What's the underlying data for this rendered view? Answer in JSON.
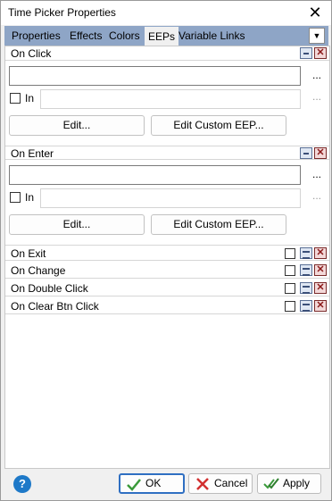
{
  "window": {
    "title": "Time Picker Properties"
  },
  "tabs": [
    {
      "label": "Properties"
    },
    {
      "label": "Effects"
    },
    {
      "label": "Colors"
    },
    {
      "label": "EEPs"
    },
    {
      "label": "Variable Links"
    }
  ],
  "active_tab": "EEPs",
  "sections": {
    "on_click": {
      "title": "On Click",
      "value": "",
      "in_label": "In",
      "in_checked": false,
      "in_value": "",
      "edit_label": "Edit...",
      "edit_custom_label": "Edit Custom EEP...",
      "browse": "...",
      "in_browse": "..."
    },
    "on_enter": {
      "title": "On Enter",
      "value": "",
      "in_label": "In",
      "in_checked": false,
      "in_value": "",
      "edit_label": "Edit...",
      "edit_custom_label": "Edit Custom EEP...",
      "browse": "...",
      "in_browse": "..."
    },
    "collapsed": [
      {
        "title": "On Exit"
      },
      {
        "title": "On Change"
      },
      {
        "title": "On Double Click"
      },
      {
        "title": "On Clear Btn Click"
      }
    ]
  },
  "footer": {
    "ok_label": "OK",
    "cancel_label": "Cancel",
    "apply_label": "Apply"
  },
  "colors": {
    "tab_bar": "#8ea5c6",
    "help": "#1e79c8",
    "ok_border": "#2f6fc2",
    "check_green": "#3a9a3a",
    "cancel_red": "#d23030"
  }
}
